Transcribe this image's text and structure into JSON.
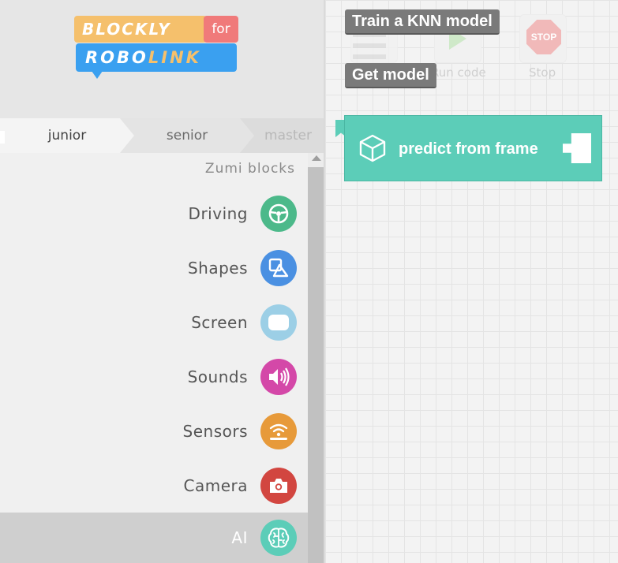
{
  "logo": {
    "top_text": "BLOCKLY",
    "for_text": "for",
    "bottom_text_a": "ROBO",
    "bottom_text_b": "LINK"
  },
  "tabs": [
    {
      "label": "junior",
      "active": true
    },
    {
      "label": "senior",
      "active": false
    },
    {
      "label": "master",
      "active": false
    }
  ],
  "category_header": "Zumi blocks",
  "categories": [
    {
      "label": "Driving",
      "icon": "steering-wheel-icon",
      "color": "#4cb98a"
    },
    {
      "label": "Shapes",
      "icon": "shapes-icon",
      "color": "#4a90e2"
    },
    {
      "label": "Screen",
      "icon": "screen-icon",
      "color": "#9ccfe6"
    },
    {
      "label": "Sounds",
      "icon": "speaker-icon",
      "color": "#d448a8"
    },
    {
      "label": "Sensors",
      "icon": "sensor-icon",
      "color": "#e79a3a"
    },
    {
      "label": "Camera",
      "icon": "camera-icon",
      "color": "#d24640"
    },
    {
      "label": "AI",
      "icon": "brain-icon",
      "color": "#5ccdb8",
      "selected": true
    }
  ],
  "toolbar": {
    "run_label": "Run code",
    "stop_label": "Stop",
    "stop_sign_text": "STOP"
  },
  "tooltips": {
    "train": "Train a KNN model",
    "model": "Get model"
  },
  "block": {
    "label": "predict from frame",
    "color": "#5ccdb8"
  }
}
